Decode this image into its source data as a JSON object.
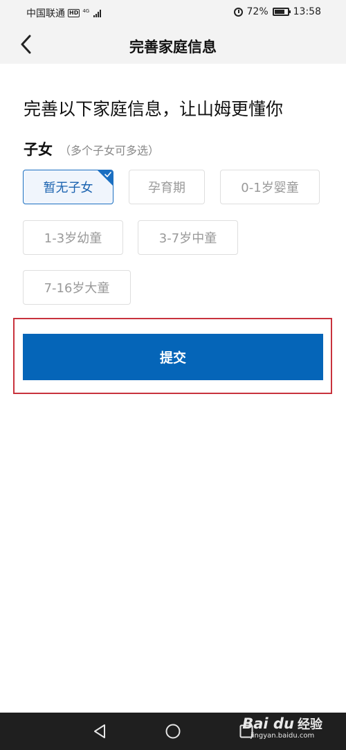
{
  "status_bar": {
    "carrier": "中国联通",
    "hd_badge": "HD",
    "network": "4G",
    "battery": "72%",
    "time": "13:58",
    "icons": [
      "alarm-icon",
      "battery-icon",
      "signal-icon"
    ]
  },
  "nav": {
    "title": "完善家庭信息",
    "back_icon": "chevron-left-icon"
  },
  "headline": "完善以下家庭信息，让山姆更懂你",
  "section": {
    "title": "子女",
    "hint": "（多个子女可多选）"
  },
  "options": [
    {
      "label": "暂无子女",
      "selected": true
    },
    {
      "label": "孕育期",
      "selected": false
    },
    {
      "label": "0-1岁婴童",
      "selected": false
    },
    {
      "label": "1-3岁幼童",
      "selected": false
    },
    {
      "label": "3-7岁中童",
      "selected": false
    },
    {
      "label": "7-16岁大童",
      "selected": false
    }
  ],
  "submit_label": "提交",
  "colors": {
    "accent": "#0565b8",
    "highlight": "#c8323c",
    "selected_bg": "#f0f5fc"
  },
  "watermark": {
    "logo": "Bai du",
    "text": "经验",
    "url": "jingyan.baidu.com"
  }
}
